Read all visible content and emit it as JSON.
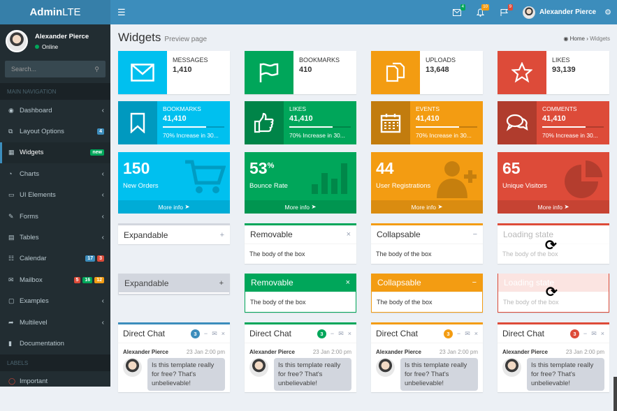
{
  "logo": {
    "bold": "Admin",
    "light": "LTE"
  },
  "topbar": {
    "badges": [
      {
        "icon": "envelope-icon",
        "count": "4",
        "color": "#00a65a"
      },
      {
        "icon": "bell-icon",
        "count": "10",
        "color": "#f39c12"
      },
      {
        "icon": "flag-icon",
        "count": "9",
        "color": "#dd4b39"
      }
    ],
    "user": "Alexander Pierce"
  },
  "sidebar": {
    "user": "Alexander Pierce",
    "status": "Online",
    "search_placeholder": "Search...",
    "header": "MAIN NAVIGATION",
    "labels_header": "LABELS",
    "items": [
      {
        "label": "Dashboard",
        "icon": "dashboard-icon"
      },
      {
        "label": "Layout Options",
        "icon": "files-icon",
        "badges": [
          {
            "t": "4",
            "c": "#3c8dbc"
          }
        ]
      },
      {
        "label": "Widgets",
        "icon": "th-icon",
        "badges": [
          {
            "t": "new",
            "c": "#00a65a"
          }
        ],
        "active": true
      },
      {
        "label": "Charts",
        "icon": "pie-chart-icon"
      },
      {
        "label": "UI Elements",
        "icon": "laptop-icon"
      },
      {
        "label": "Forms",
        "icon": "edit-icon"
      },
      {
        "label": "Tables",
        "icon": "table-icon"
      },
      {
        "label": "Calendar",
        "icon": "calendar-icon",
        "badges": [
          {
            "t": "17",
            "c": "#3c8dbc"
          },
          {
            "t": "3",
            "c": "#dd4b39"
          }
        ]
      },
      {
        "label": "Mailbox",
        "icon": "envelope-icon",
        "badges": [
          {
            "t": "5",
            "c": "#dd4b39"
          },
          {
            "t": "16",
            "c": "#00a65a"
          },
          {
            "t": "12",
            "c": "#f39c12"
          }
        ]
      },
      {
        "label": "Examples",
        "icon": "folder-icon"
      },
      {
        "label": "Multilevel",
        "icon": "share-icon"
      },
      {
        "label": "Documentation",
        "icon": "book-icon"
      }
    ],
    "label_items": [
      {
        "label": "Important"
      }
    ]
  },
  "page": {
    "title": "Widgets",
    "subtitle": "Preview page",
    "breadcrumb_home": "Home",
    "breadcrumb_current": "Widgets"
  },
  "info_boxes": [
    {
      "label": "MESSAGES",
      "value": "1,410",
      "color": "#00c0ef",
      "icon": "envelope-icon"
    },
    {
      "label": "BOOKMARKS",
      "value": "410",
      "color": "#00a65a",
      "icon": "flag-icon"
    },
    {
      "label": "UPLOADS",
      "value": "13,648",
      "color": "#f39c12",
      "icon": "files-icon"
    },
    {
      "label": "LIKES",
      "value": "93,139",
      "color": "#dd4b39",
      "icon": "star-icon"
    }
  ],
  "info_boxes_filled": [
    {
      "label": "BOOKMARKS",
      "value": "41,410",
      "progress": "70% Increase in 30...",
      "pct": 70,
      "color": "#00c0ef",
      "icon": "bookmark-icon"
    },
    {
      "label": "LIKES",
      "value": "41,410",
      "progress": "70% Increase in 30...",
      "pct": 70,
      "color": "#00a65a",
      "icon": "thumbs-up-icon"
    },
    {
      "label": "EVENTS",
      "value": "41,410",
      "progress": "70% Increase in 30...",
      "pct": 70,
      "color": "#f39c12",
      "icon": "calendar-icon"
    },
    {
      "label": "COMMENTS",
      "value": "41,410",
      "progress": "70% Increase in 30...",
      "pct": 70,
      "color": "#dd4b39",
      "icon": "comments-icon"
    }
  ],
  "small_boxes": [
    {
      "value": "150",
      "sup": "",
      "label": "New Orders",
      "more": "More info",
      "color": "#00c0ef",
      "icon": "cart-icon"
    },
    {
      "value": "53",
      "sup": "%",
      "label": "Bounce Rate",
      "more": "More info",
      "color": "#00a65a",
      "icon": "bar-chart-icon"
    },
    {
      "value": "44",
      "sup": "",
      "label": "User Registrations",
      "more": "More info",
      "color": "#f39c12",
      "icon": "person-add-icon"
    },
    {
      "value": "65",
      "sup": "",
      "label": "Unique Visitors",
      "more": "More info",
      "color": "#dd4b39",
      "icon": "pie-chart-icon"
    }
  ],
  "boxes_row1": [
    {
      "title": "Expandable",
      "tool": "+",
      "body": ""
    },
    {
      "title": "Removable",
      "tool": "×",
      "body": "The body of the box"
    },
    {
      "title": "Collapsable",
      "tool": "−",
      "body": "The body of the box"
    },
    {
      "title": "Loading state",
      "tool": "",
      "body": "The body of the box"
    }
  ],
  "boxes_row2": [
    {
      "title": "Expandable",
      "tool": "+",
      "body": ""
    },
    {
      "title": "Removable",
      "tool": "×",
      "body": "The body of the box"
    },
    {
      "title": "Collapsable",
      "tool": "−",
      "body": "The body of the box"
    },
    {
      "title": "Loading state",
      "tool": "",
      "body": "The body of the box"
    }
  ],
  "chats": [
    {
      "title": "Direct Chat",
      "count": "3",
      "color": "#3c8dbc",
      "name": "Alexander Pierce",
      "time": "23 Jan 2:00 pm",
      "msg": "Is this template really for free? That's unbelievable!"
    },
    {
      "title": "Direct Chat",
      "count": "3",
      "color": "#00a65a",
      "name": "Alexander Pierce",
      "time": "23 Jan 2:00 pm",
      "msg": "Is this template really for free? That's unbelievable!"
    },
    {
      "title": "Direct Chat",
      "count": "3",
      "color": "#f39c12",
      "name": "Alexander Pierce",
      "time": "23 Jan 2:00 pm",
      "msg": "Is this template really for free? That's unbelievable!"
    },
    {
      "title": "Direct Chat",
      "count": "3",
      "color": "#dd4b39",
      "name": "Alexander Pierce",
      "time": "23 Jan 2:00 pm",
      "msg": "Is this template really for free? That's unbelievable!"
    }
  ]
}
